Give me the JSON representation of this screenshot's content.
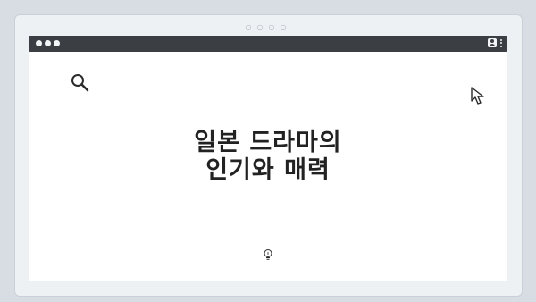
{
  "page": {
    "title_line1": "일본 드라마의",
    "title_line2": "인기와 매력"
  },
  "icons": {
    "window_dots": "window-indicator-dots",
    "search": "search-icon",
    "cursor": "cursor-icon",
    "lightbulb": "lightbulb-icon",
    "user": "user-icon",
    "menu": "kebab-menu-icon"
  },
  "colors": {
    "background": "#d7dde3",
    "browser_bar": "#3b3e42",
    "content": "#ffffff",
    "text": "#222222"
  }
}
